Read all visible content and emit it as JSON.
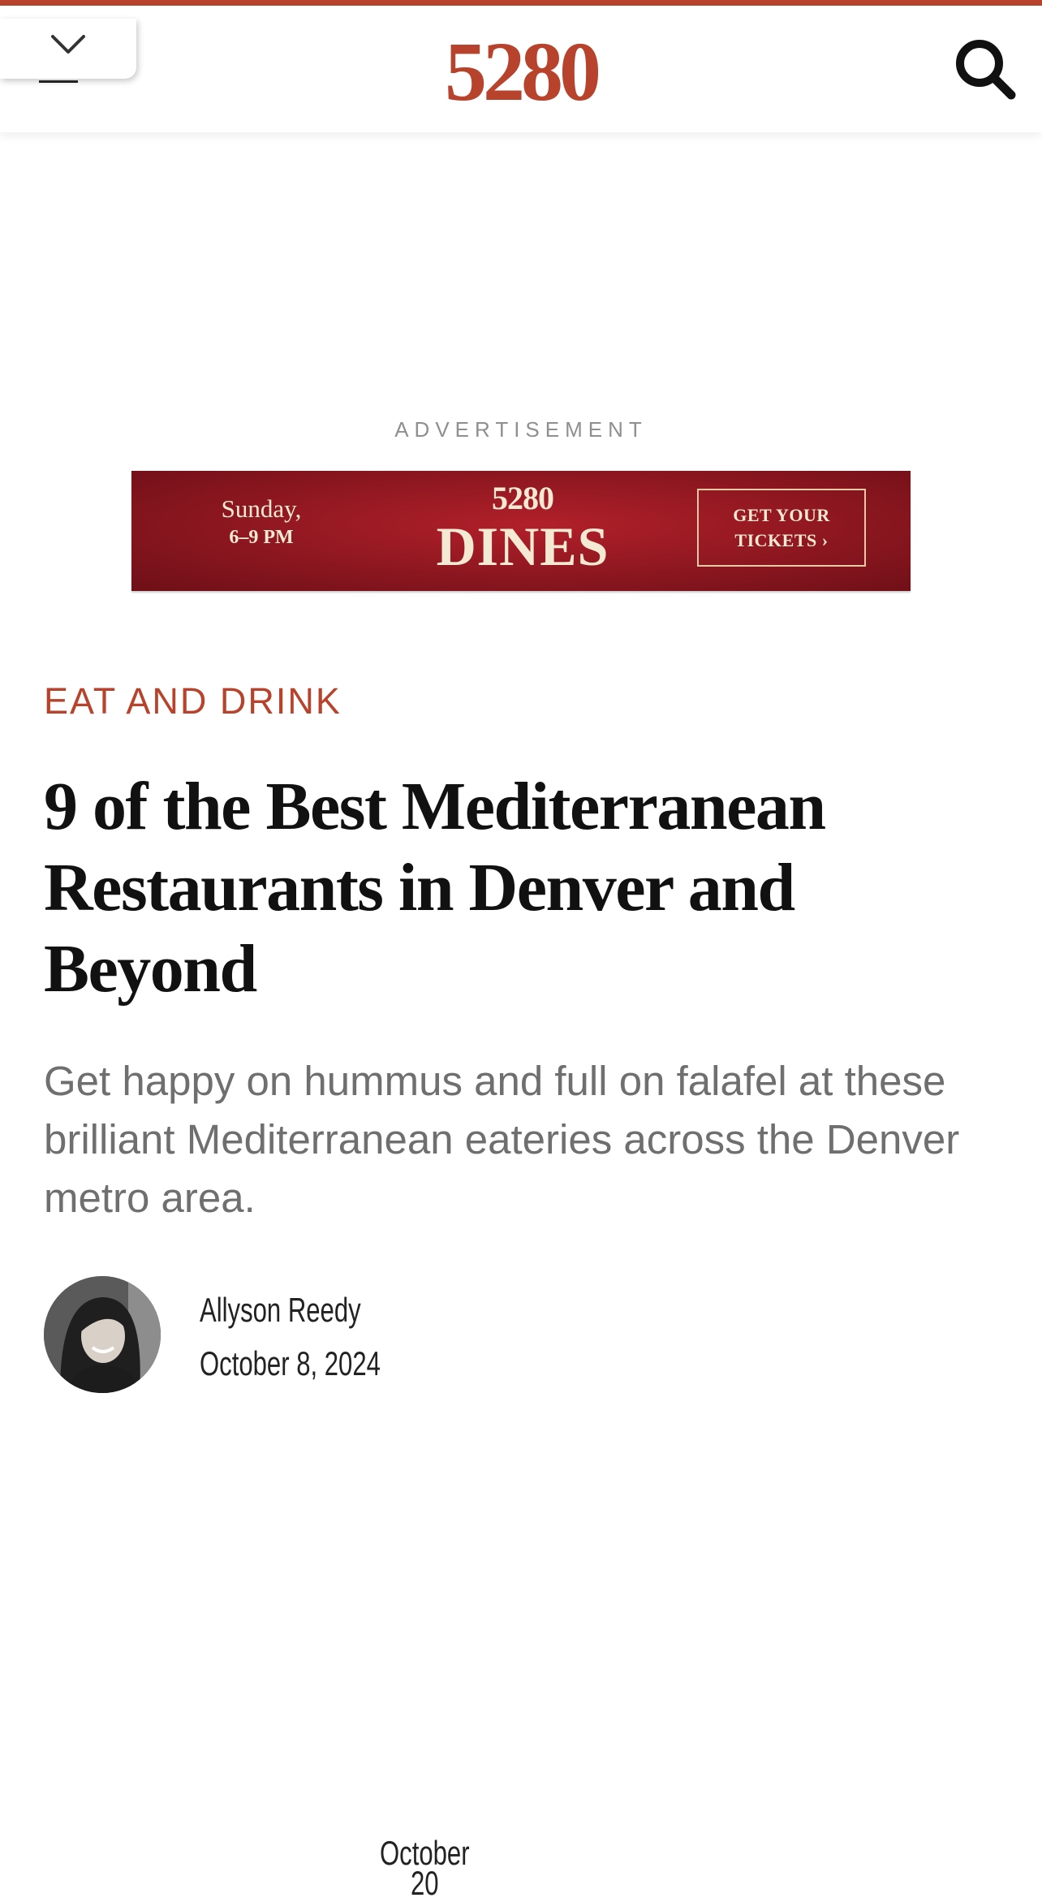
{
  "header": {
    "logo_text": "5280",
    "menu_icon": "chevron-down-icon",
    "search_icon": "search-icon",
    "accent_color": "#b8432c"
  },
  "advertisement": {
    "label": "ADVERTISEMENT",
    "banner": {
      "day": "Sunday,",
      "date": "October 20",
      "time": "6–9 PM",
      "brand": "5280",
      "title": "DINES",
      "cta_line1": "GET YOUR",
      "cta_line2": "TICKETS ›",
      "background_color": "#8a161f"
    }
  },
  "article": {
    "category": "EAT AND DRINK",
    "headline": "9 of the Best Mediterranean Restaurants in Denver and Beyond",
    "dek": "Get happy on hummus and full on falafel at these brilliant Mediterranean eateries across the Denver metro area.",
    "author": "Allyson Reedy",
    "date": "October 8, 2024"
  }
}
